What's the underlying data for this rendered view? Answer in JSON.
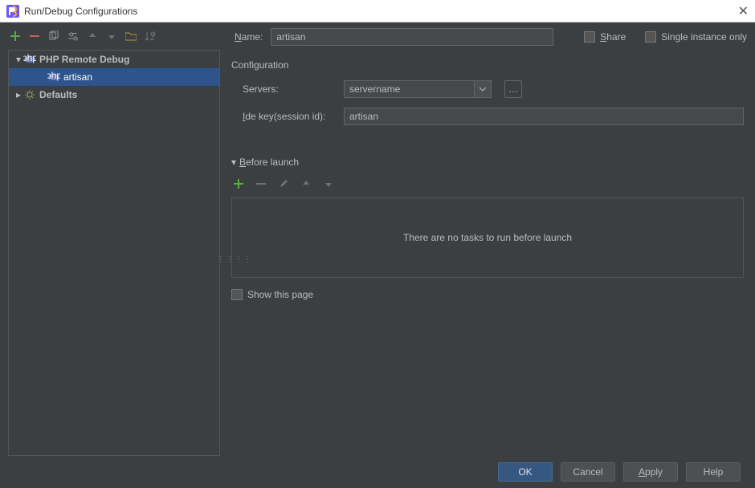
{
  "titlebar": {
    "title": "Run/Debug Configurations"
  },
  "nameRow": {
    "label": "Name:",
    "value": "artisan",
    "share": "Share",
    "single": "Single instance only"
  },
  "tree": {
    "groupLabel": "PHP Remote Debug",
    "selectedChild": "artisan",
    "defaults": "Defaults"
  },
  "config": {
    "title": "Configuration",
    "serversLabel": "Servers:",
    "serversValue": "servername",
    "ideKeyLabel": "Ide key(session id):",
    "ideKeyValue": "artisan"
  },
  "before": {
    "title": "Before launch",
    "empty": "There are no tasks to run before launch"
  },
  "showThisPage": "Show this page",
  "buttons": {
    "ok": "OK",
    "cancel": "Cancel",
    "apply": "Apply",
    "help": "Help"
  }
}
